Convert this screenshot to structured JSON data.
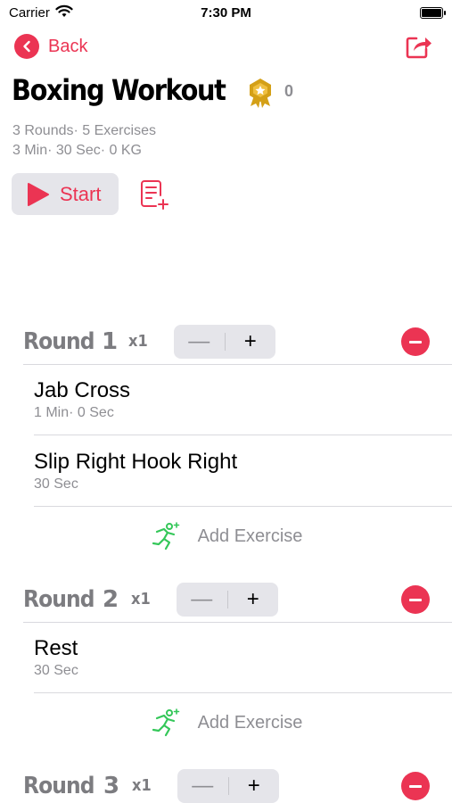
{
  "status": {
    "carrier": "Carrier",
    "time": "7:30 PM"
  },
  "nav": {
    "back_label": "Back"
  },
  "workout": {
    "title": "Boxing Workout",
    "medal_count": "0",
    "meta_line1": "3 Rounds· 5 Exercises",
    "meta_line2": "3 Min· 30 Sec· 0 KG"
  },
  "actions": {
    "start_label": "Start"
  },
  "stepper": {
    "minus": "—",
    "plus": "+"
  },
  "rounds": [
    {
      "label": "Round",
      "number": "1",
      "multiplier": "x1",
      "exercises": [
        {
          "name": "Jab Cross",
          "duration": "1 Min· 0 Sec"
        },
        {
          "name": "Slip Right Hook Right",
          "duration": "30 Sec"
        }
      ],
      "add_label": "Add Exercise"
    },
    {
      "label": "Round",
      "number": "2",
      "multiplier": "x1",
      "exercises": [
        {
          "name": "Rest",
          "duration": "30 Sec"
        }
      ],
      "add_label": "Add Exercise"
    },
    {
      "label": "Round",
      "number": "3",
      "multiplier": "x1",
      "exercises": []
    }
  ],
  "colors": {
    "accent": "#eb3453",
    "add_icon": "#34c759",
    "muted": "#8e8e93",
    "medal": "#d4a017"
  },
  "icons": [
    "chevron-left-icon",
    "share-icon",
    "medal-icon",
    "play-icon",
    "notes-add-icon",
    "minus-icon",
    "running-figure-icon",
    "wifi-icon",
    "battery-icon"
  ]
}
